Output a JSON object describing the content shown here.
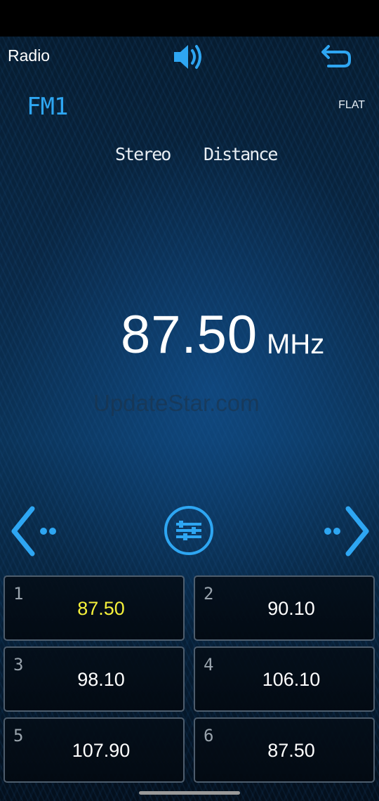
{
  "header": {
    "title": "Radio",
    "speaker_icon": "speaker-icon",
    "back_icon": "back-icon"
  },
  "status": {
    "band": "FM1",
    "eq_preset": "FLAT",
    "stereo_label": "Stereo",
    "distance_label": "Distance"
  },
  "tuner": {
    "frequency": "87.50",
    "unit": "MHz",
    "watermark": "UpdateStar.com"
  },
  "controls": {
    "prev_icon": "chevron-left-icon",
    "settings_icon": "sliders-icon",
    "next_icon": "chevron-right-icon"
  },
  "presets": [
    {
      "num": "1",
      "value": "87.50",
      "active": true
    },
    {
      "num": "2",
      "value": "90.10",
      "active": false
    },
    {
      "num": "3",
      "value": "98.10",
      "active": false
    },
    {
      "num": "4",
      "value": "106.10",
      "active": false
    },
    {
      "num": "5",
      "value": "107.90",
      "active": false
    },
    {
      "num": "6",
      "value": "87.50",
      "active": false
    }
  ],
  "colors": {
    "accent": "#2ea6f2",
    "active_preset": "#f5f03a"
  }
}
